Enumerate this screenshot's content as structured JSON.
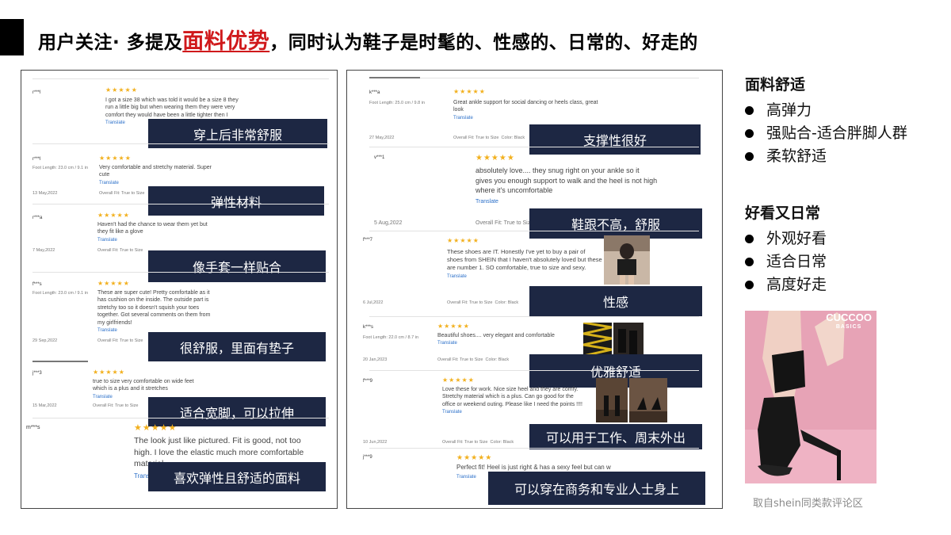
{
  "title": {
    "prefix": "用户关注· 多提及",
    "highlight": "面料优势",
    "suffix": "，同时认为鞋子是时髦的、性感的、日常的、好走的"
  },
  "left_panel": {
    "reviews": [
      {
        "user": "r***l",
        "stars": "★★★★★",
        "body": "I got a size 38 which was told it would be a size 8 they run a little big but when wearing them they were very comfort they would have been a little tighter then I",
        "translate": "Translate",
        "label": "穿上后非常舒服"
      },
      {
        "user": "r***l",
        "stars": "★★★★★",
        "meta": "Foot Length: 23.0 cm / 9.1 in",
        "body": "Very comfortable and stretchy material. Super cute",
        "translate": "Translate",
        "date": "13 May,2022",
        "fit": "Overall Fit: True to Size",
        "label": "弹性材料"
      },
      {
        "user": "r***a",
        "stars": "★★★★★",
        "body": "Haven't had the chance to wear them yet but they fit like a glove",
        "translate": "Translate",
        "date": "7 May,2022",
        "fit": "Overall Fit: True to Size",
        "label": "像手套一样贴合"
      },
      {
        "user": "f***s",
        "stars": "★★★★★",
        "meta": "Foot Length: 23.0 cm / 9.1 in",
        "body": "These are super cute! Pretty comfortable as it has cushion on the inside. The outside part is stretchy too so it doesn't squish your toes together. Got several comments on them from my girlfriends!",
        "translate": "Translate",
        "date": "29 Sep,2022",
        "fit": "Overall Fit: True to Size",
        "label": "很舒服，里面有垫子"
      },
      {
        "user": "j***3",
        "stars": "★★★★★",
        "body": "true to size very comfortable on wide feet which is a plus and it stretches",
        "translate": "Translate",
        "date": "15 Mar,2022",
        "fit": "Overall Fit: True to Size",
        "label": "适合宽脚，可以拉伸"
      },
      {
        "user": "m***s",
        "stars": "★★★★★",
        "body": "The look just like pictured. Fit is good, not too high. I love the elastic much more comfortable material",
        "translate": "Translate",
        "label": "喜欢弹性且舒适的面料"
      }
    ]
  },
  "right_panel": {
    "reviews": [
      {
        "user": "k***a",
        "stars": "★★★★★",
        "meta": "Foot Length: 25.0 cm / 9.8 in",
        "body": "Great ankle support for social dancing or heels class, great look",
        "translate": "Translate",
        "date": "27 May,2022",
        "fit": "Overall Fit: True to Size",
        "color": "Color: Black",
        "label": "支撑性很好"
      },
      {
        "user": "v***1",
        "stars": "★★★★★",
        "body": "absolutely love.... they snug right on your ankle so it gives you enough support to walk and the heel is not high where it's uncomfortable",
        "translate": "Translate",
        "date": "5 Aug,2022",
        "fit": "Overall Fit: True to Size",
        "label": "鞋跟不高，舒服"
      },
      {
        "user": "f***7",
        "stars": "★★★★★",
        "body": "These shoes are IT. Honestly I've yet to buy a pair of shoes from SHEIN that I haven't absolutely loved but these are number 1. SO comfortable, true to size and sexy.",
        "translate": "Translate",
        "date": "6 Jul,2022",
        "fit": "Overall Fit: True to Size",
        "color": "Color: Black",
        "label": "性感"
      },
      {
        "user": "k***s",
        "stars": "★★★★★",
        "meta": "Foot Length: 22.0 cm / 8.7 in",
        "body": "Beautiful shoes.... very elegant and comfortable",
        "translate": "Translate",
        "date": "20 Jan,2023",
        "fit": "Overall Fit: True to Size",
        "color": "Color: Black",
        "label": "优雅舒适"
      },
      {
        "user": "f***9",
        "stars": "★★★★★",
        "body": "Love these for work. Nice size heel and they are comfy. Stretchy material which is a plus. Can go good for the office or weekend outing. Please like I need the points !!!!",
        "translate": "Translate",
        "date": "10 Jun,2022",
        "fit": "Overall Fit: True to Size",
        "color": "Color: Black",
        "label": "可以用于工作、周末外出"
      },
      {
        "user": "j***9",
        "stars": "★★★★★",
        "body": "Perfect fit! Heel is just right & has a sexy feel but can w",
        "translate": "Translate",
        "label": "可以穿在商务和专业人士身上"
      }
    ]
  },
  "sidebar": {
    "group1": {
      "heading": "面料舒适",
      "items": [
        "高弹力",
        "强贴合-适合胖脚人群",
        "柔软舒适"
      ]
    },
    "group2": {
      "heading": "好看又日常",
      "items": [
        "外观好看",
        "适合日常",
        "高度好走"
      ]
    }
  },
  "product": {
    "brand": "CUCCOO",
    "sub": "BASICS"
  },
  "caption": "取自shein同类款评论区",
  "colors": {
    "label_bg": "#1d2743",
    "highlight": "#d0191b",
    "stars": "#f2b01e",
    "product_bg": "#e7a3b6"
  }
}
